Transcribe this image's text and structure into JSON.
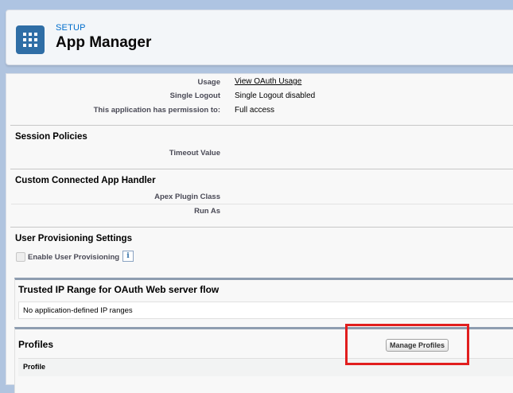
{
  "header": {
    "setup_label": "SETUP",
    "title": "App Manager",
    "icon": "grid-apps-icon"
  },
  "oauth_policies": {
    "rows": [
      {
        "label": "Usage",
        "value": "View OAuth Usage"
      },
      {
        "label": "Single Logout",
        "value": "Single Logout disabled"
      },
      {
        "label": "This application has permission to:",
        "value": "Full access"
      }
    ]
  },
  "session_policies": {
    "title": "Session Policies",
    "rows": [
      {
        "label": "Timeout Value",
        "value": ""
      }
    ]
  },
  "custom_handler": {
    "title": "Custom Connected App Handler",
    "rows": [
      {
        "label": "Apex Plugin Class",
        "value": ""
      },
      {
        "label": "Run As",
        "value": ""
      }
    ]
  },
  "user_provisioning": {
    "title": "User Provisioning Settings",
    "checkbox_label": "Enable User Provisioning",
    "checked": false,
    "info_glyph": "i"
  },
  "trusted_ip": {
    "title": "Trusted IP Range for OAuth Web server flow",
    "empty_text": "No application-defined IP ranges"
  },
  "profiles": {
    "title": "Profiles",
    "button_label": "Manage Profiles",
    "column_header": "Profile"
  },
  "colors": {
    "highlight": "#e11e1e",
    "brand_icon": "#2f6ea6"
  }
}
